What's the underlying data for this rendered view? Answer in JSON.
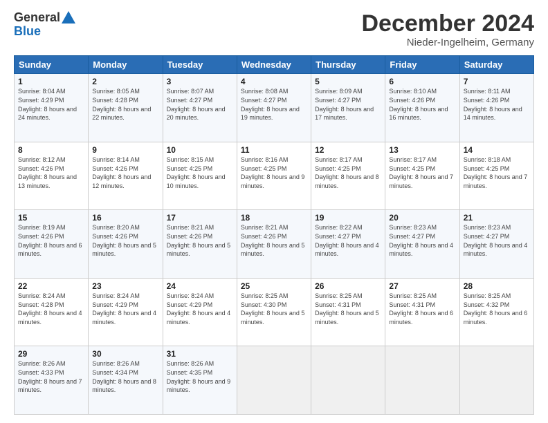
{
  "logo": {
    "general": "General",
    "blue": "Blue"
  },
  "header": {
    "title": "December 2024",
    "subtitle": "Nieder-Ingelheim, Germany"
  },
  "days_of_week": [
    "Sunday",
    "Monday",
    "Tuesday",
    "Wednesday",
    "Thursday",
    "Friday",
    "Saturday"
  ],
  "weeks": [
    [
      {
        "day": "1",
        "info": "Sunrise: 8:04 AM\nSunset: 4:29 PM\nDaylight: 8 hours and 24 minutes."
      },
      {
        "day": "2",
        "info": "Sunrise: 8:05 AM\nSunset: 4:28 PM\nDaylight: 8 hours and 22 minutes."
      },
      {
        "day": "3",
        "info": "Sunrise: 8:07 AM\nSunset: 4:27 PM\nDaylight: 8 hours and 20 minutes."
      },
      {
        "day": "4",
        "info": "Sunrise: 8:08 AM\nSunset: 4:27 PM\nDaylight: 8 hours and 19 minutes."
      },
      {
        "day": "5",
        "info": "Sunrise: 8:09 AM\nSunset: 4:27 PM\nDaylight: 8 hours and 17 minutes."
      },
      {
        "day": "6",
        "info": "Sunrise: 8:10 AM\nSunset: 4:26 PM\nDaylight: 8 hours and 16 minutes."
      },
      {
        "day": "7",
        "info": "Sunrise: 8:11 AM\nSunset: 4:26 PM\nDaylight: 8 hours and 14 minutes."
      }
    ],
    [
      {
        "day": "8",
        "info": "Sunrise: 8:12 AM\nSunset: 4:26 PM\nDaylight: 8 hours and 13 minutes."
      },
      {
        "day": "9",
        "info": "Sunrise: 8:14 AM\nSunset: 4:26 PM\nDaylight: 8 hours and 12 minutes."
      },
      {
        "day": "10",
        "info": "Sunrise: 8:15 AM\nSunset: 4:25 PM\nDaylight: 8 hours and 10 minutes."
      },
      {
        "day": "11",
        "info": "Sunrise: 8:16 AM\nSunset: 4:25 PM\nDaylight: 8 hours and 9 minutes."
      },
      {
        "day": "12",
        "info": "Sunrise: 8:17 AM\nSunset: 4:25 PM\nDaylight: 8 hours and 8 minutes."
      },
      {
        "day": "13",
        "info": "Sunrise: 8:17 AM\nSunset: 4:25 PM\nDaylight: 8 hours and 7 minutes."
      },
      {
        "day": "14",
        "info": "Sunrise: 8:18 AM\nSunset: 4:25 PM\nDaylight: 8 hours and 7 minutes."
      }
    ],
    [
      {
        "day": "15",
        "info": "Sunrise: 8:19 AM\nSunset: 4:26 PM\nDaylight: 8 hours and 6 minutes."
      },
      {
        "day": "16",
        "info": "Sunrise: 8:20 AM\nSunset: 4:26 PM\nDaylight: 8 hours and 5 minutes."
      },
      {
        "day": "17",
        "info": "Sunrise: 8:21 AM\nSunset: 4:26 PM\nDaylight: 8 hours and 5 minutes."
      },
      {
        "day": "18",
        "info": "Sunrise: 8:21 AM\nSunset: 4:26 PM\nDaylight: 8 hours and 5 minutes."
      },
      {
        "day": "19",
        "info": "Sunrise: 8:22 AM\nSunset: 4:27 PM\nDaylight: 8 hours and 4 minutes."
      },
      {
        "day": "20",
        "info": "Sunrise: 8:23 AM\nSunset: 4:27 PM\nDaylight: 8 hours and 4 minutes."
      },
      {
        "day": "21",
        "info": "Sunrise: 8:23 AM\nSunset: 4:27 PM\nDaylight: 8 hours and 4 minutes."
      }
    ],
    [
      {
        "day": "22",
        "info": "Sunrise: 8:24 AM\nSunset: 4:28 PM\nDaylight: 8 hours and 4 minutes."
      },
      {
        "day": "23",
        "info": "Sunrise: 8:24 AM\nSunset: 4:29 PM\nDaylight: 8 hours and 4 minutes."
      },
      {
        "day": "24",
        "info": "Sunrise: 8:24 AM\nSunset: 4:29 PM\nDaylight: 8 hours and 4 minutes."
      },
      {
        "day": "25",
        "info": "Sunrise: 8:25 AM\nSunset: 4:30 PM\nDaylight: 8 hours and 5 minutes."
      },
      {
        "day": "26",
        "info": "Sunrise: 8:25 AM\nSunset: 4:31 PM\nDaylight: 8 hours and 5 minutes."
      },
      {
        "day": "27",
        "info": "Sunrise: 8:25 AM\nSunset: 4:31 PM\nDaylight: 8 hours and 6 minutes."
      },
      {
        "day": "28",
        "info": "Sunrise: 8:25 AM\nSunset: 4:32 PM\nDaylight: 8 hours and 6 minutes."
      }
    ],
    [
      {
        "day": "29",
        "info": "Sunrise: 8:26 AM\nSunset: 4:33 PM\nDaylight: 8 hours and 7 minutes."
      },
      {
        "day": "30",
        "info": "Sunrise: 8:26 AM\nSunset: 4:34 PM\nDaylight: 8 hours and 8 minutes."
      },
      {
        "day": "31",
        "info": "Sunrise: 8:26 AM\nSunset: 4:35 PM\nDaylight: 8 hours and 9 minutes."
      },
      null,
      null,
      null,
      null
    ]
  ]
}
